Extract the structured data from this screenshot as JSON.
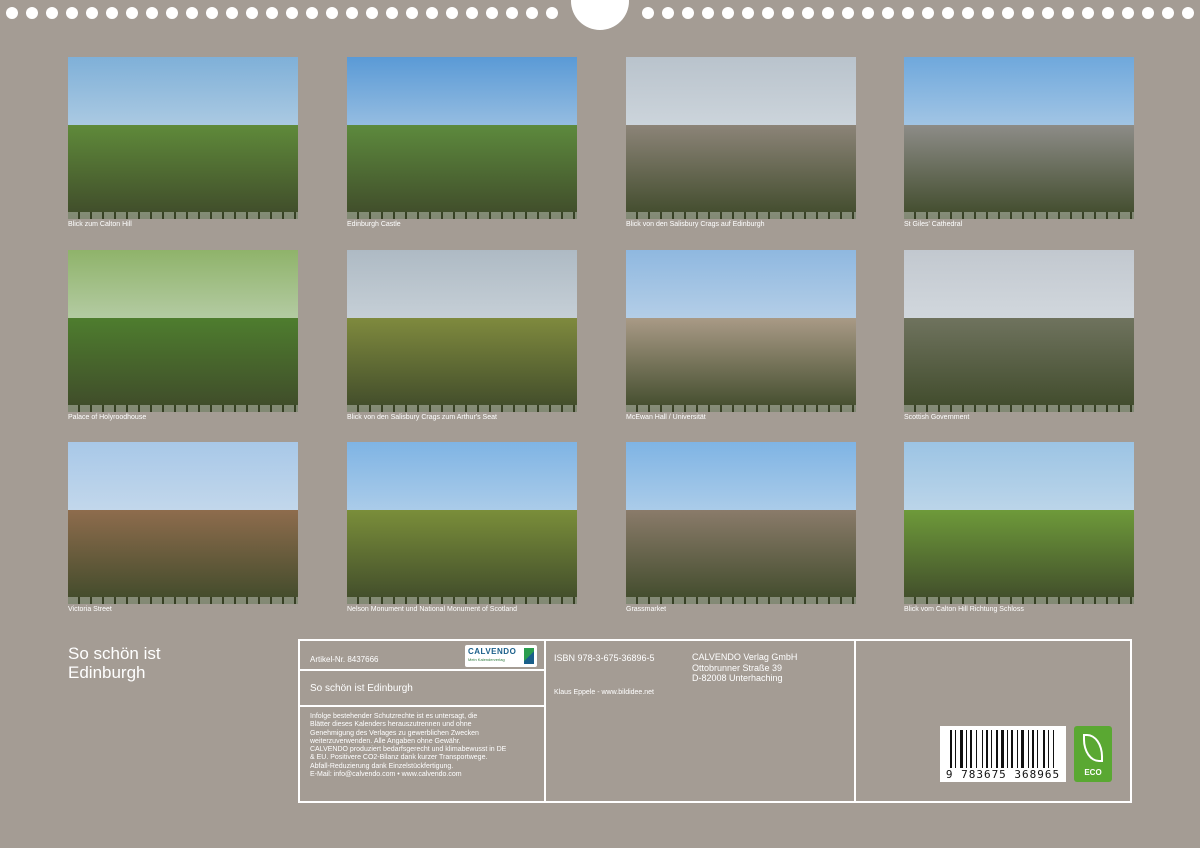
{
  "photos": [
    {
      "caption": "Blick zum Calton Hill",
      "sky": "#7fb0d8",
      "ground": "#5f8a3a"
    },
    {
      "caption": "Edinburgh Castle",
      "sky": "#5a9ad6",
      "ground": "#5d8a3d"
    },
    {
      "caption": "Blick von den Salisbury Crags auf Edinburgh",
      "sky": "#b9c3cc",
      "ground": "#8c8478"
    },
    {
      "caption": "St Giles' Cathedral",
      "sky": "#6fa8dc",
      "ground": "#8d8c88"
    },
    {
      "caption": "Palace of Holyroodhouse",
      "sky": "#8fb36a",
      "ground": "#4e7d2e"
    },
    {
      "caption": "Blick von den Salisbury Crags zum Arthur's Seat",
      "sky": "#aebac4",
      "ground": "#7f8a3e"
    },
    {
      "caption": "McEwan Hall / Universität",
      "sky": "#8fb8e0",
      "ground": "#a99a86"
    },
    {
      "caption": "Scottish Government",
      "sky": "#c2c8cf",
      "ground": "#6f735e"
    },
    {
      "caption": "Victoria Street",
      "sky": "#a8c8e8",
      "ground": "#8e6c4d"
    },
    {
      "caption": "Nelson Monument und National Monument of Scotland",
      "sky": "#7fb4e4",
      "ground": "#7a8e3a"
    },
    {
      "caption": "Grassmarket",
      "sky": "#7fb4e4",
      "ground": "#8a7b6a"
    },
    {
      "caption": "Blick vom Calton Hill Richtung Schloss",
      "sky": "#9cc4e4",
      "ground": "#6e9a3a"
    }
  ],
  "title": {
    "line1": "So schön ist",
    "line2": "Edinburgh"
  },
  "info": {
    "artikel": "Artikel-Nr. 8437666",
    "logo_name": "CALVENDO",
    "logo_tag": "Mein Kalenderverlag",
    "product_title": "So schön ist Edinburgh",
    "notice_lines": [
      "Infolge bestehender Schutzrechte ist es untersagt, die",
      "Blätter dieses Kalenders herauszutrennen und ohne",
      "Genehmigung des Verlages zu gewerblichen Zwecken",
      "weiterzuverwenden. Alle Angaben ohne Gewähr.",
      "CALVENDO produziert bedarfsgerecht und klimabewusst in DE",
      "& EU. Positivere CO2-Bilanz dank kurzer Transportwege.",
      "Abfall-Reduzierung dank Einzelstückfertigung.",
      "E-Mail: info@calvendo.com • www.calvendo.com"
    ],
    "isbn": "ISBN 978-3-675-36896-5",
    "author": "Klaus Eppele - www.bildidee.net",
    "publisher_lines": [
      "CALVENDO Verlag GmbH",
      "Ottobrunner Straße 39",
      "D-82008 Unterhaching"
    ],
    "barcode_number": "9 783675 368965",
    "eco_label": "ECO"
  },
  "colors": {
    "background": "#a49c94",
    "line": "#ffffff"
  }
}
